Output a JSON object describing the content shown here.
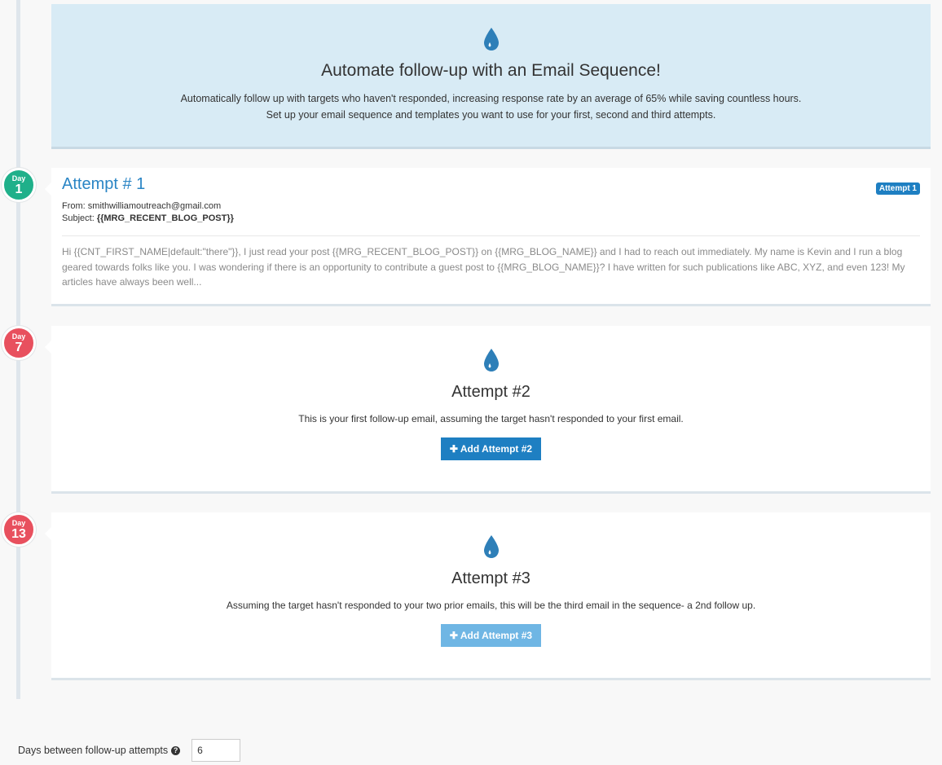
{
  "hero": {
    "icon": "water-drop-icon",
    "title": "Automate follow-up with an Email Sequence!",
    "line1": "Automatically follow up with targets who haven't responded, increasing response rate by an average of 65% while saving countless hours.",
    "line2": "Set up your email sequence and templates you want to use for your first, second and third attempts."
  },
  "colors": {
    "accent": "#1e7fc2",
    "day_green": "#1fb08a",
    "day_red": "#e8505e",
    "hero_bg": "#d8ebf5"
  },
  "attempts": [
    {
      "day_label": "Day",
      "day_num": "1",
      "title": "Attempt # 1",
      "tag": "Attempt 1",
      "from_label": "From: ",
      "from": "smithwilliamoutreach@gmail.com",
      "subject_label": "Subject: ",
      "subject": "{{MRG_RECENT_BLOG_POST}}",
      "preview": "Hi {{CNT_FIRST_NAME|default:\"there\"}}, I just read your post {{MRG_RECENT_BLOG_POST}} on {{MRG_BLOG_NAME}} and I had to reach out immediately. My name is Kevin and I run a blog geared towards folks like you.  I was wondering if there is an opportunity to contribute a guest post to {{MRG_BLOG_NAME}}? I have written for such publications like ABC, XYZ, and even 123! My articles have always been well..."
    },
    {
      "day_label": "Day",
      "day_num": "7",
      "title": "Attempt #2",
      "description": "This is your first follow-up email, assuming the target hasn't responded to your first email.",
      "button": "Add Attempt #2"
    },
    {
      "day_label": "Day",
      "day_num": "13",
      "title": "Attempt #3",
      "description": "Assuming the target hasn't responded to your two prior emails, this will be the third email in the sequence- a 2nd follow up.",
      "button": "Add Attempt #3"
    }
  ],
  "settings": {
    "days_between_label": "Days between follow-up attempts",
    "days_between_value": "6",
    "help_icon": "question-circle-icon"
  }
}
